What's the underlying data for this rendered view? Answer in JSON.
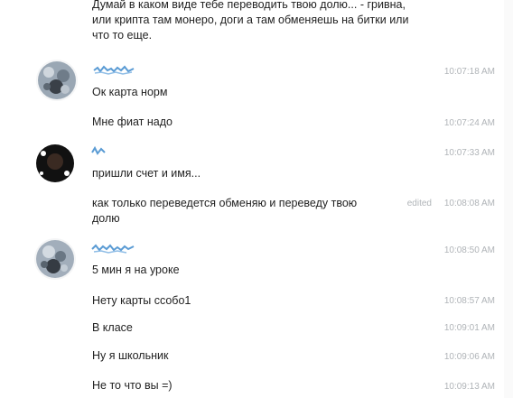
{
  "messages": [
    {
      "text": "Думай в каком виде тебе переводить твою долю... - гривна, или крипта там монеро, доги а там обменяешь на битки или что то еще.",
      "time": ""
    },
    {
      "text": "Ок карта норм",
      "time": "10:07:18 AM"
    },
    {
      "text": "Мне фиат надо",
      "time": "10:07:24 AM"
    },
    {
      "text": "пришли счет и имя...",
      "time": "10:07:33 AM"
    },
    {
      "text": "как только переведется обменяю и переведу твою долю",
      "time": "10:08:08 AM",
      "edited": "edited"
    },
    {
      "text": "5 мин я на уроке",
      "time": "10:08:50 AM"
    },
    {
      "text": "Нету карты ссобо1",
      "time": "10:08:57 AM"
    },
    {
      "text": "В класе",
      "time": "10:09:01 AM"
    },
    {
      "text": "Ну я школьник",
      "time": "10:09:06 AM"
    },
    {
      "text": "Не то что вы =)",
      "time": "10:09:13 AM"
    }
  ],
  "avatars": [
    {
      "icon": "blurred-avatar-icon"
    },
    {
      "icon": "dark-avatar-icon"
    },
    {
      "icon": "blurred-avatar-icon"
    }
  ],
  "colors": {
    "timestamp": "#b0b4b8",
    "name_scribble": "#5a9bd4",
    "text": "#222222"
  }
}
